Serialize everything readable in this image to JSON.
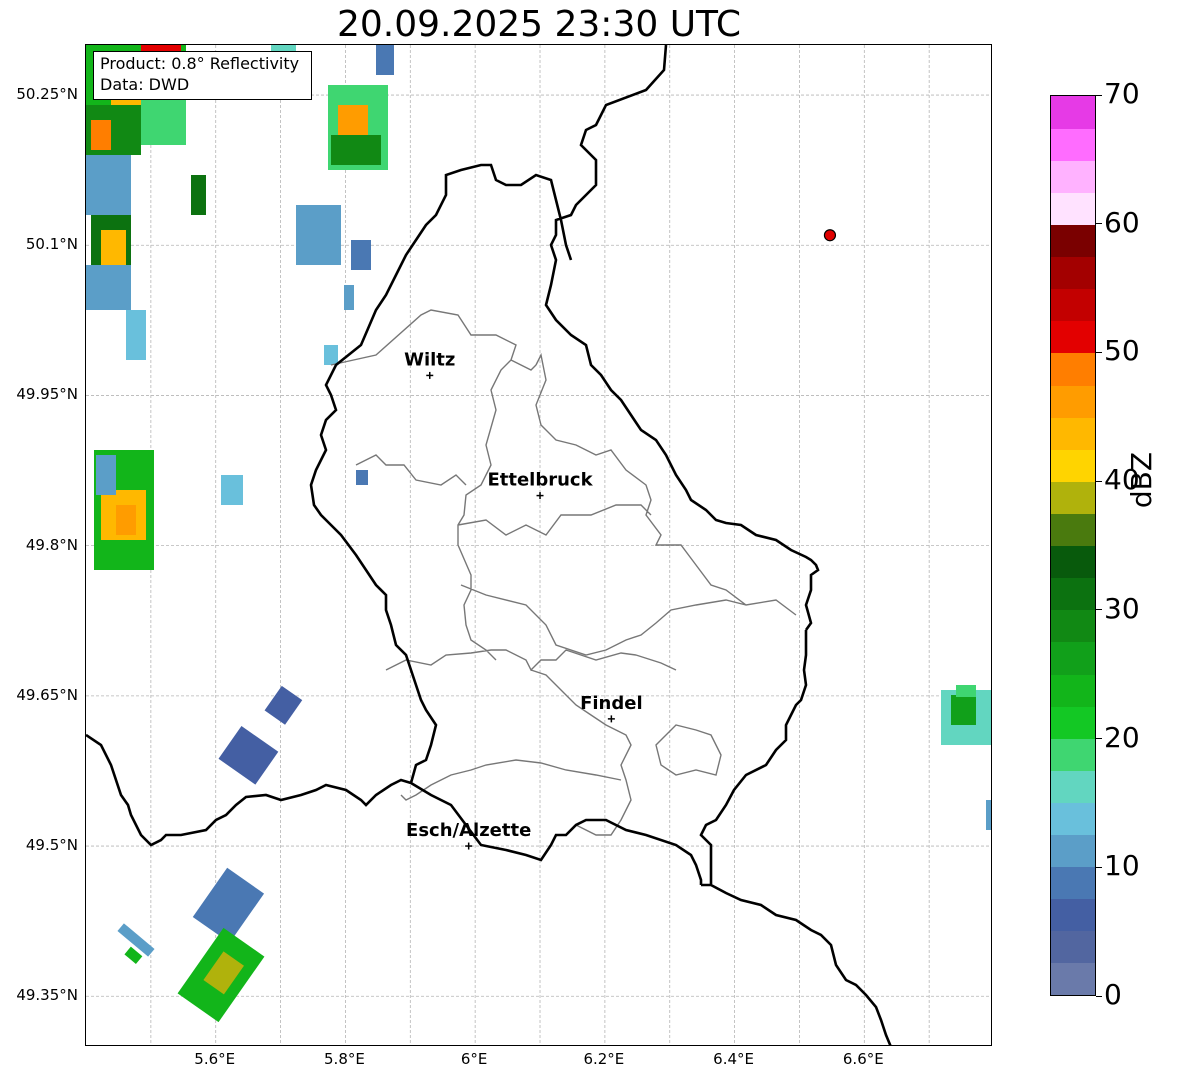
{
  "title": "20.09.2025 23:30 UTC",
  "info_box": {
    "product": "Product: 0.8° Reflectivity",
    "data_source": "Data: DWD"
  },
  "lat_ticks": [
    {
      "lat": 50.25,
      "label": "50.25°N"
    },
    {
      "lat": 50.1,
      "label": "50.1°N"
    },
    {
      "lat": 49.95,
      "label": "49.95°N"
    },
    {
      "lat": 49.8,
      "label": "49.8°N"
    },
    {
      "lat": 49.65,
      "label": "49.65°N"
    },
    {
      "lat": 49.5,
      "label": "49.5°N"
    },
    {
      "lat": 49.35,
      "label": "49.35°N"
    }
  ],
  "lon_ticks": [
    {
      "lon": 5.6,
      "label": "5.6°E"
    },
    {
      "lon": 5.8,
      "label": "5.8°E"
    },
    {
      "lon": 6.0,
      "label": "6°E"
    },
    {
      "lon": 6.2,
      "label": "6.2°E"
    },
    {
      "lon": 6.4,
      "label": "6.4°E"
    },
    {
      "lon": 6.6,
      "label": "6.6°E"
    }
  ],
  "map_extent": {
    "lon_min": 5.4,
    "lon_max": 6.8,
    "lat_min": 49.3,
    "lat_max": 50.3
  },
  "cities": [
    {
      "name": "Wiltz",
      "lon": 5.93,
      "lat": 49.97
    },
    {
      "name": "Ettelbruck",
      "lon": 6.1,
      "lat": 49.85
    },
    {
      "name": "Findel",
      "lon": 6.21,
      "lat": 49.627
    },
    {
      "name": "Esch/Alzette",
      "lon": 5.99,
      "lat": 49.5
    }
  ],
  "radar_site": {
    "lon": 6.547,
    "lat": 50.11,
    "color": "#e00000"
  },
  "colorbar": {
    "label": "dBZ",
    "min": 0,
    "max": 70,
    "ticks": [
      "0",
      "10",
      "20",
      "30",
      "40",
      "50",
      "60",
      "70"
    ],
    "colors": [
      "#6a7aaa",
      "#5266a0",
      "#445fa3",
      "#4a78b3",
      "#5b9ec8",
      "#69c0dc",
      "#62d6c0",
      "#3fd671",
      "#13c824",
      "#12b51a",
      "#11a01a",
      "#118914",
      "#0c7210",
      "#085a0c",
      "#4a7a0e",
      "#b0b20c",
      "#ffd400",
      "#ffb800",
      "#ff9c00",
      "#ff7e00",
      "#e30000",
      "#c30000",
      "#a30000",
      "#7a0000",
      "#ffe2ff",
      "#ffb2ff",
      "#ff6cff",
      "#e63ae6"
    ]
  }
}
